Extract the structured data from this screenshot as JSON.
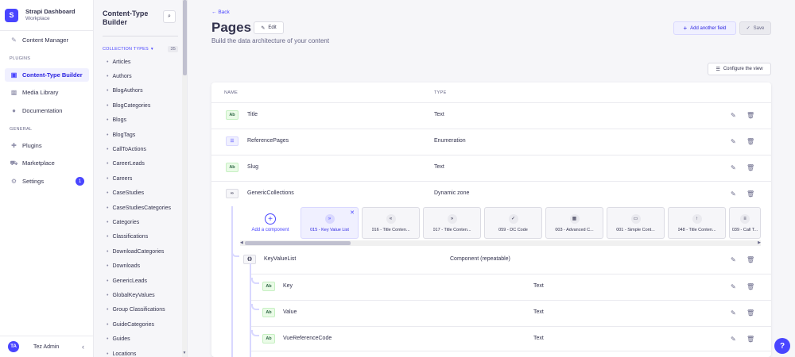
{
  "brand": {
    "title": "Strapi Dashboard",
    "subtitle": "Workplace",
    "logo": "S"
  },
  "mainnav": {
    "content_manager": "Content Manager",
    "plugins_section": "PLUGINS",
    "ctb": "Content-Type Builder",
    "media": "Media Library",
    "documentation": "Documentation",
    "general_section": "GENERAL",
    "plugins": "Plugins",
    "marketplace": "Marketplace",
    "settings": "Settings",
    "settings_badge": "1"
  },
  "user": {
    "initials": "TA",
    "name": "Tez Admin"
  },
  "subnav": {
    "title": "Content-Type Builder",
    "collection_label": "COLLECTION TYPES",
    "count": "35",
    "items": [
      "Articles",
      "Authors",
      "BlogAuthors",
      "BlogCategories",
      "Blogs",
      "BlogTags",
      "CallToActions",
      "CareerLeads",
      "Careers",
      "CaseStudies",
      "CaseStudiesCategories",
      "Categories",
      "Classifications",
      "DownloadCategories",
      "Downloads",
      "GenericLeads",
      "GlobalKeyValues",
      "Group Classifications",
      "GuideCategories",
      "Guides",
      "Locations"
    ]
  },
  "header": {
    "back": "Back",
    "title": "Pages",
    "edit": "Edit",
    "subtitle": "Build the data architecture of your content",
    "add_field": "Add another field",
    "save": "Save",
    "configure": "Configure the view"
  },
  "table": {
    "col_name": "NAME",
    "col_type": "TYPE",
    "rows": [
      {
        "icon": "Ab",
        "name": "Title",
        "type": "Text"
      },
      {
        "icon": "list-icon",
        "name": "ReferencePages",
        "type": "Enumeration"
      },
      {
        "icon": "Ab",
        "name": "Slug",
        "type": "Text"
      },
      {
        "icon": "infinity-icon",
        "name": "GenericCollections",
        "type": "Dynamic zone"
      }
    ],
    "component": {
      "name": "KeyValueList",
      "type": "Component (repeatable)"
    },
    "nested": [
      {
        "icon": "Ab",
        "name": "Key",
        "type": "Text"
      },
      {
        "icon": "Ab",
        "name": "Value",
        "type": "Text"
      },
      {
        "icon": "Ab",
        "name": "VueReferenceCode",
        "type": "Text"
      }
    ]
  },
  "dynamic_zone": {
    "add_label": "Add a component",
    "components": [
      {
        "label": "015 - Key Value List",
        "icon": "»",
        "active": true
      },
      {
        "label": "016 - Title Conten...",
        "icon": "«"
      },
      {
        "label": "017 - Title Conten...",
        "icon": "»"
      },
      {
        "label": "059 - DC Code",
        "icon": "✓"
      },
      {
        "label": "003 - Advanced C...",
        "icon": "▦"
      },
      {
        "label": "001 - Simple Cont...",
        "icon": "▭"
      },
      {
        "label": "048 - Title Conten...",
        "icon": "↑"
      },
      {
        "label": "039 - Call T...",
        "icon": "≡"
      }
    ]
  },
  "help": "?"
}
